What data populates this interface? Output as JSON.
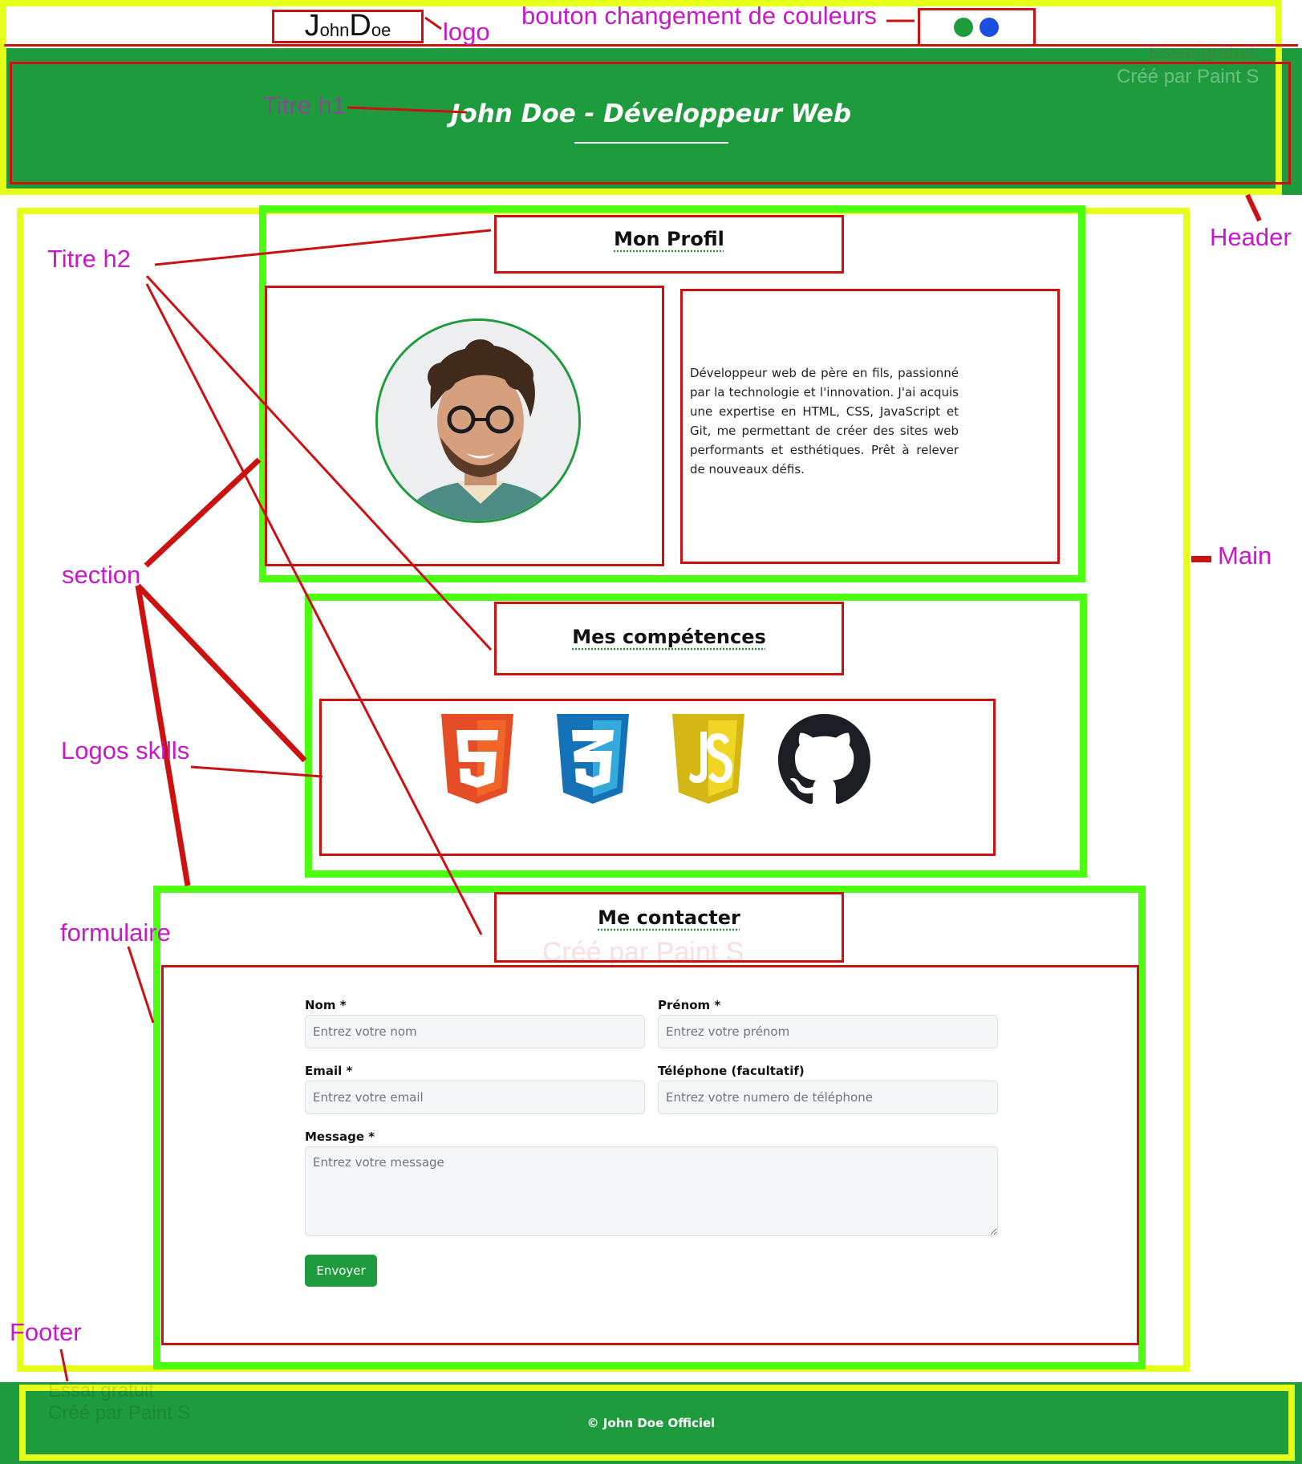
{
  "header": {
    "logo": {
      "first_initial": "J",
      "first_rest": "ohn",
      "last_initial": "D",
      "last_rest": "oe"
    },
    "title_h1": "John Doe - Développeur Web",
    "color_switcher": {
      "options": [
        "#1e9b3c",
        "#1a4fe0"
      ]
    }
  },
  "main": {
    "profile": {
      "heading": "Mon Profil",
      "description": "Développeur web de père en fils, passionné par la technologie et l'innovation. J'ai acquis une expertise en HTML, CSS, JavaScript et Git, me permettant de créer des sites web performants et esthétiques. Prêt à relever de nouveaux défis."
    },
    "skills": {
      "heading": "Mes compétences",
      "logos": [
        {
          "icon": "html5-icon",
          "color": "#e44d26"
        },
        {
          "icon": "css3-icon",
          "color": "#1572b6"
        },
        {
          "icon": "javascript-icon",
          "color": "#e5c61a"
        },
        {
          "icon": "github-icon",
          "color": "#1b1f23"
        }
      ]
    },
    "contact": {
      "heading": "Me contacter",
      "fields": {
        "nom": {
          "label": "Nom *",
          "placeholder": "Entrez votre nom"
        },
        "prenom": {
          "label": "Prénom *",
          "placeholder": "Entrez votre prénom"
        },
        "email": {
          "label": "Email *",
          "placeholder": "Entrez votre email"
        },
        "telephone": {
          "label": "Téléphone (facultatif)",
          "placeholder": "Entrez votre numero de téléphone"
        },
        "message": {
          "label": "Message *",
          "placeholder": "Entrez votre message"
        }
      },
      "submit_label": "Envoyer"
    }
  },
  "footer": {
    "text": "© John Doe Officiel"
  },
  "annotations": {
    "logo": "logo",
    "color_button": "bouton changement de couleurs",
    "title_h1": "Titre h1",
    "header": "Header",
    "title_h2": "Titre h2",
    "main": "Main",
    "section": "section",
    "skills_logos": "Logos skills",
    "form": "formulaire",
    "footer": "Footer"
  },
  "watermarks": {
    "trial": "Essai gratuit",
    "credit": "Créé par Paint S"
  },
  "colors": {
    "accent_green": "#1e9b3c",
    "annotation_magenta": "#c819c8",
    "annotation_red": "#cc1111",
    "outline_yellow": "#e6ff1a",
    "outline_lime": "#4cff10"
  }
}
